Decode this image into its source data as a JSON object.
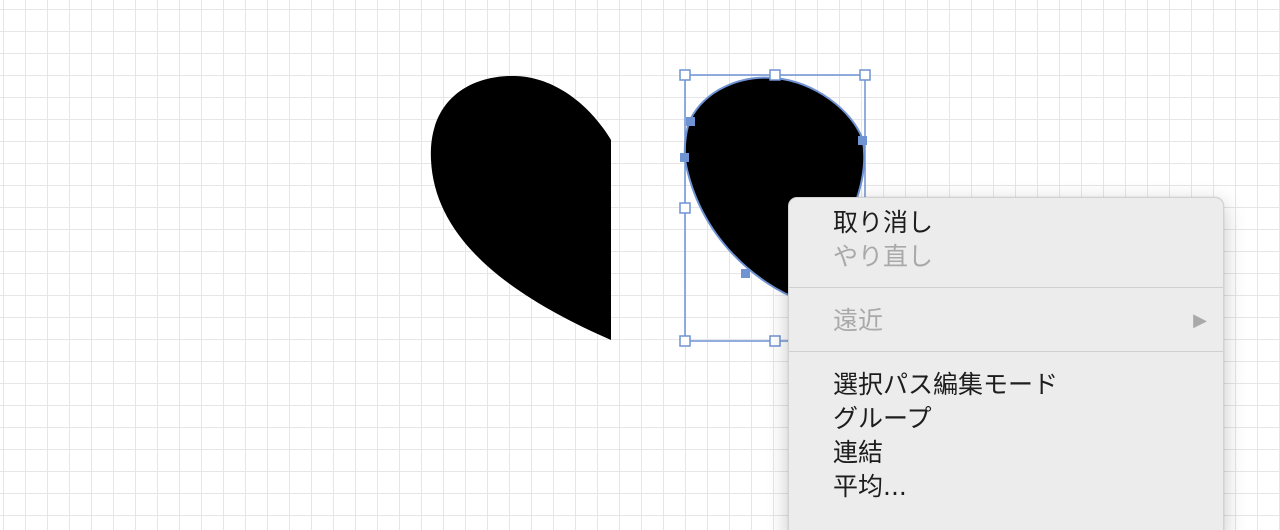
{
  "context_menu": {
    "items": [
      {
        "label": "取り消し"
      },
      {
        "label": "やり直し"
      },
      {
        "label": "遠近",
        "arrow": "▶"
      },
      {
        "label": "選択パス編集モード"
      },
      {
        "label": "グループ"
      },
      {
        "label": "連結"
      },
      {
        "label": "平均..."
      }
    ]
  },
  "colors": {
    "shape_fill": "#000000",
    "selection": "#6f93d3",
    "grid": "#e6e6ea",
    "menu_bg": "#ececec",
    "disabled_text": "#a9a9a9"
  },
  "icons": {
    "submenu": "right-triangle-icon"
  }
}
